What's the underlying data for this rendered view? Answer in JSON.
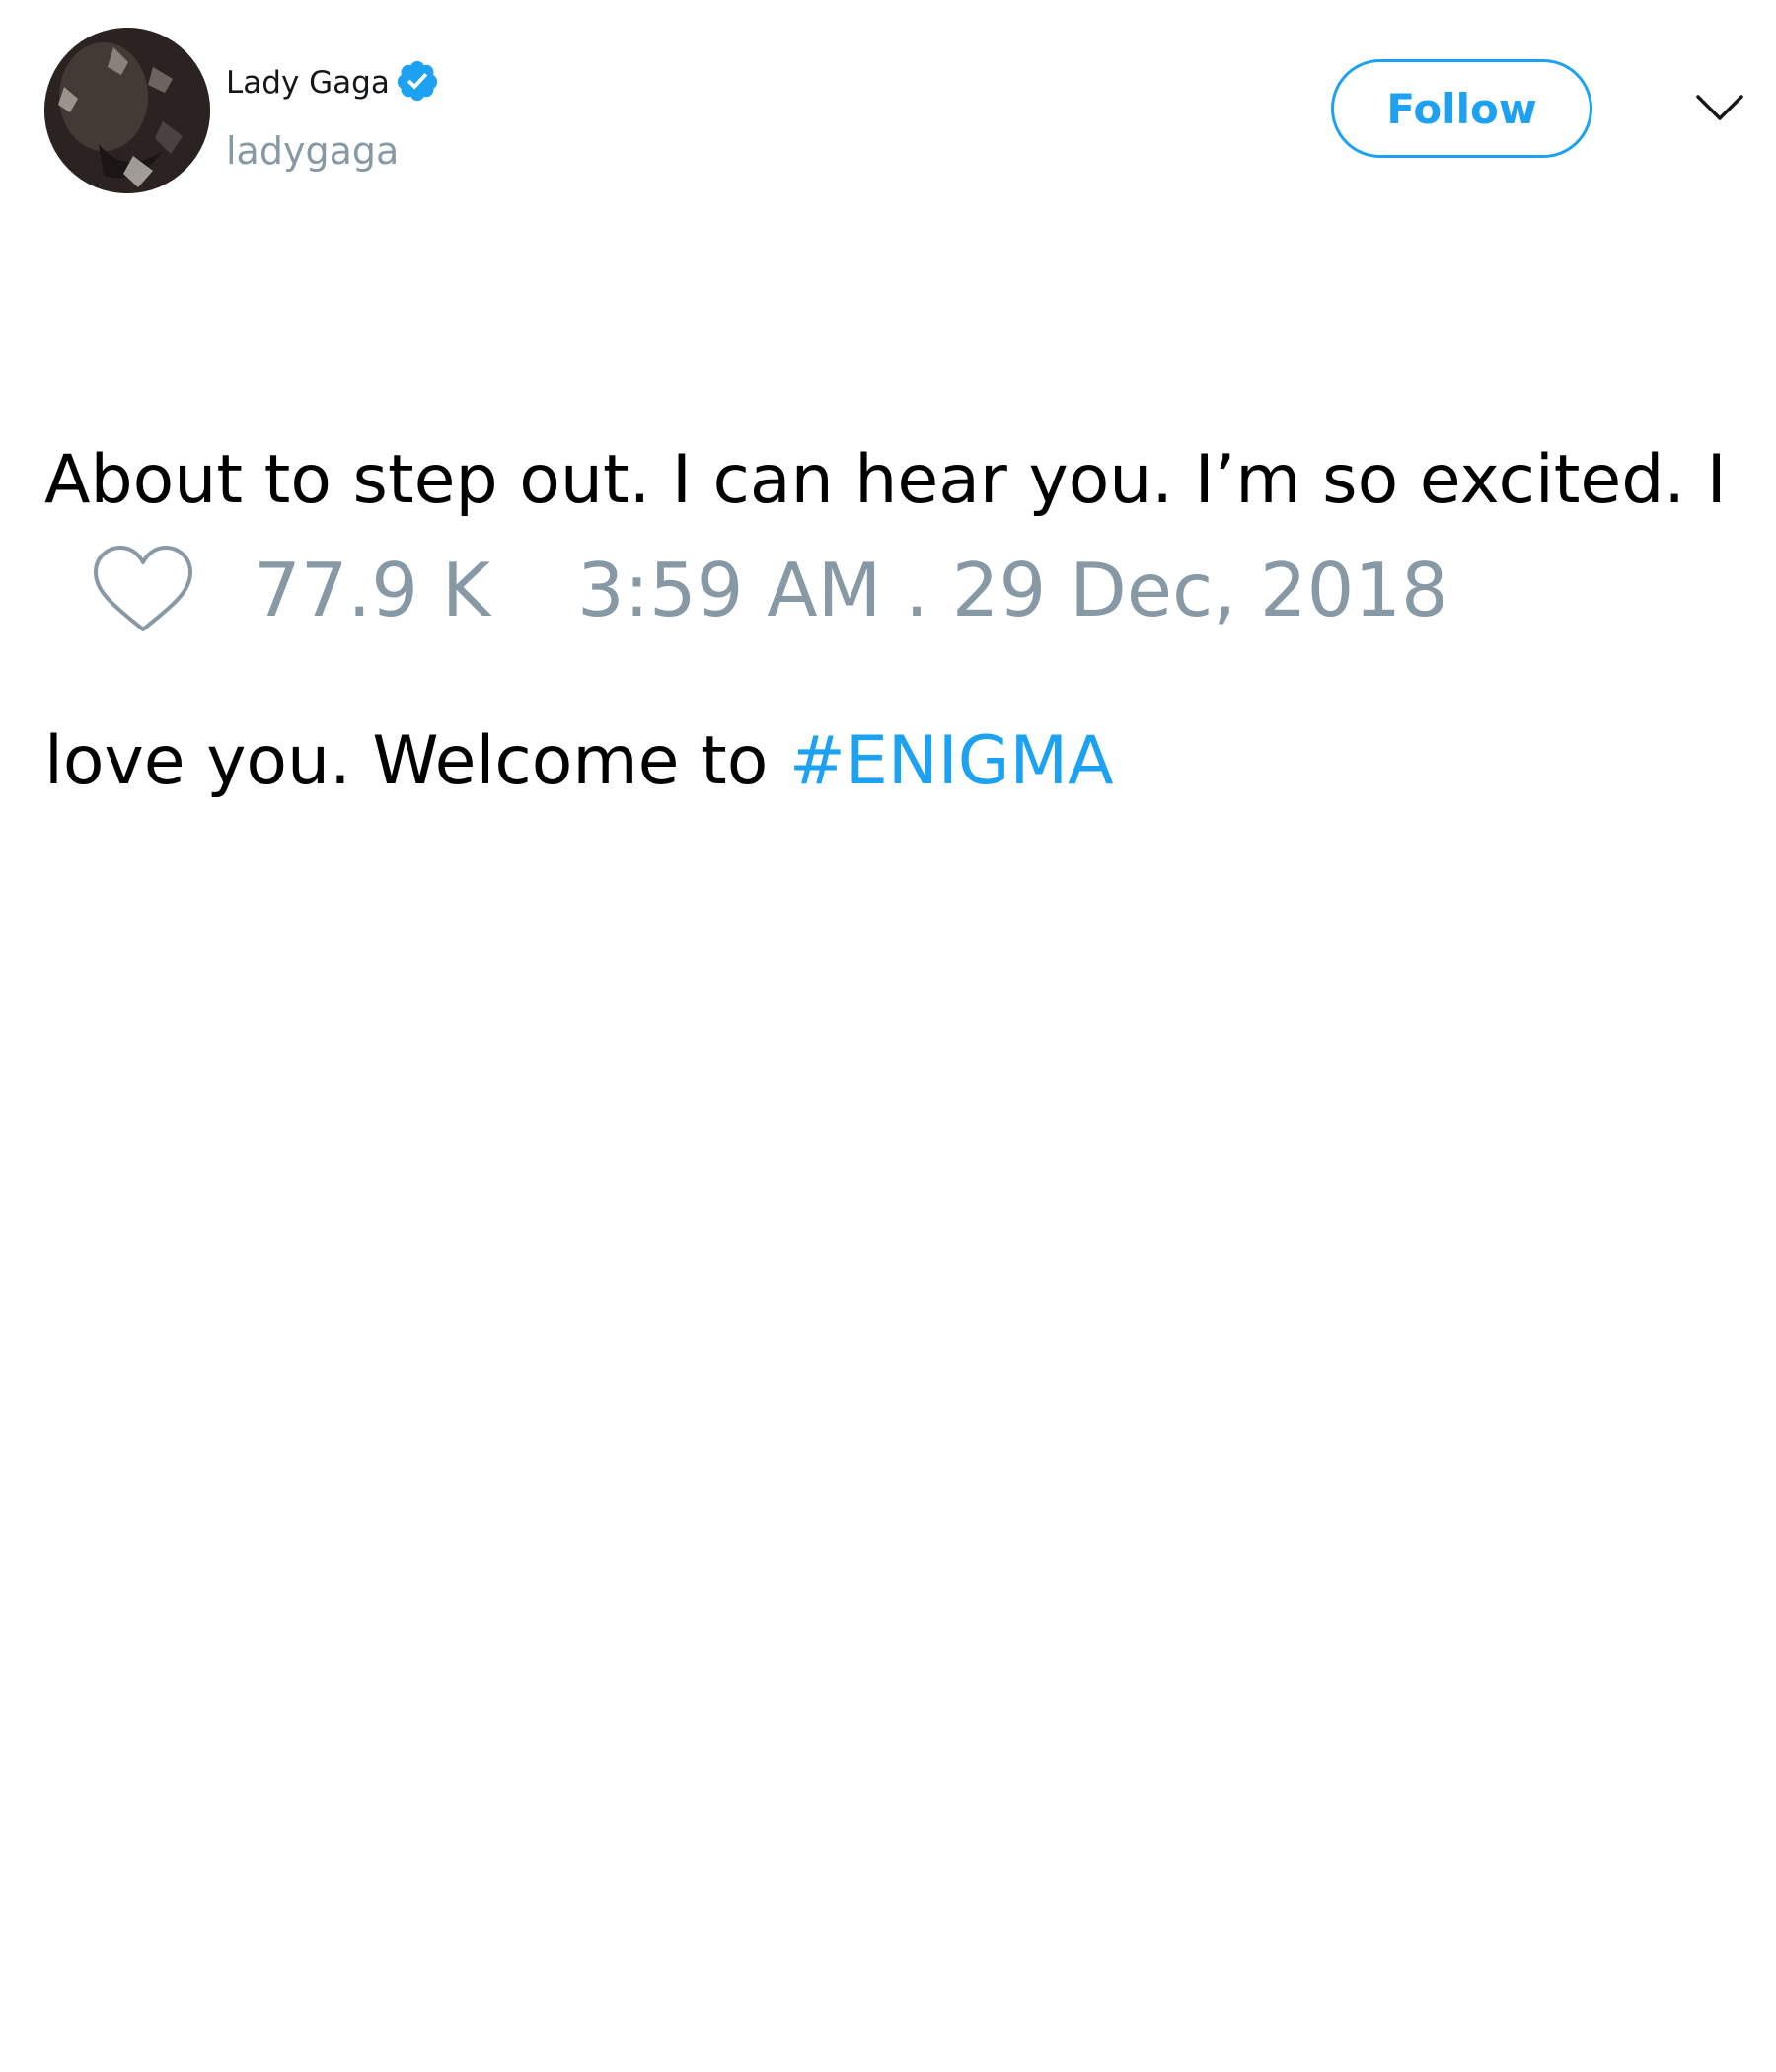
{
  "user": {
    "display_name": "Lady Gaga",
    "handle": "ladygaga",
    "avatar_icon": "profile-photo",
    "verified_icon": "verified-badge-icon"
  },
  "header": {
    "follow_label": "Follow",
    "menu_icon": "chevron-down-icon"
  },
  "tweet": {
    "text_line1": "About to step out. I can hear you. I’m so excited. I",
    "text_line2_prefix": "love you. Welcome to ",
    "hashtag": "#ENIGMA"
  },
  "footer": {
    "like_icon": "heart-icon",
    "like_count": "77.9 K",
    "timestamp": "3:59 AM . 29 Dec, 2018"
  },
  "colors": {
    "accent": "#1da1f2",
    "muted": "#8899a6",
    "text": "#000000"
  }
}
